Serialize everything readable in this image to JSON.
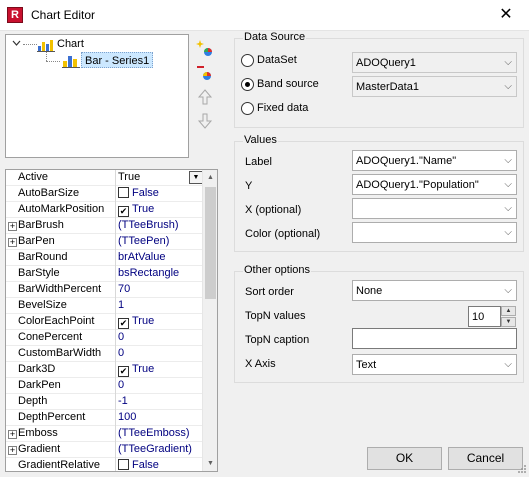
{
  "window": {
    "title": "Chart Editor",
    "close_glyph": "✕",
    "app_icon_letter": "R"
  },
  "tree": {
    "root_label": "Chart",
    "child_label": "Bar - Series1",
    "expander": "⊟"
  },
  "tree_buttons": [
    "add-series-icon",
    "delete-series-icon",
    "move-up-icon",
    "move-down-icon"
  ],
  "property_grid": {
    "rows": [
      {
        "name": "Active",
        "value": "True",
        "kind": "dropdown",
        "expandable": false
      },
      {
        "name": "AutoBarSize",
        "value": "False",
        "kind": "checkbox",
        "checked": false,
        "expandable": false
      },
      {
        "name": "AutoMarkPosition",
        "value": "True",
        "kind": "checkbox",
        "checked": true,
        "expandable": false
      },
      {
        "name": "BarBrush",
        "value": "(TTeeBrush)",
        "kind": "object",
        "expandable": true
      },
      {
        "name": "BarPen",
        "value": "(TTeePen)",
        "kind": "object",
        "expandable": true
      },
      {
        "name": "BarRound",
        "value": "brAtValue",
        "kind": "text",
        "expandable": false
      },
      {
        "name": "BarStyle",
        "value": "bsRectangle",
        "kind": "text",
        "expandable": false
      },
      {
        "name": "BarWidthPercent",
        "value": "70",
        "kind": "text",
        "expandable": false
      },
      {
        "name": "BevelSize",
        "value": "1",
        "kind": "text",
        "expandable": false
      },
      {
        "name": "ColorEachPoint",
        "value": "True",
        "kind": "checkbox",
        "checked": true,
        "expandable": false
      },
      {
        "name": "ConePercent",
        "value": "0",
        "kind": "text",
        "expandable": false
      },
      {
        "name": "CustomBarWidth",
        "value": "0",
        "kind": "text",
        "expandable": false
      },
      {
        "name": "Dark3D",
        "value": "True",
        "kind": "checkbox",
        "checked": true,
        "expandable": false
      },
      {
        "name": "DarkPen",
        "value": "0",
        "kind": "text",
        "expandable": false
      },
      {
        "name": "Depth",
        "value": "-1",
        "kind": "text",
        "expandable": false
      },
      {
        "name": "DepthPercent",
        "value": "100",
        "kind": "text",
        "expandable": false
      },
      {
        "name": "Emboss",
        "value": "(TTeeEmboss)",
        "kind": "object",
        "expandable": true
      },
      {
        "name": "Gradient",
        "value": "(TTeeGradient)",
        "kind": "object",
        "expandable": true
      },
      {
        "name": "GradientRelative",
        "value": "False",
        "kind": "checkbox",
        "checked": false,
        "expandable": false
      }
    ]
  },
  "data_source": {
    "title": "Data Source",
    "options": [
      {
        "label": "DataSet",
        "selected": false,
        "combo": "ADOQuery1",
        "disabled": true
      },
      {
        "label": "Band source",
        "selected": true,
        "combo": "MasterData1",
        "disabled": false
      },
      {
        "label": "Fixed data",
        "selected": false
      }
    ]
  },
  "values": {
    "title": "Values",
    "fields": [
      {
        "label": "Label",
        "value": "ADOQuery1.\"Name\""
      },
      {
        "label": "Y",
        "value": "ADOQuery1.\"Population\""
      },
      {
        "label": "X (optional)",
        "value": ""
      },
      {
        "label": "Color (optional)",
        "value": ""
      }
    ]
  },
  "other_options": {
    "title": "Other options",
    "sort_order": {
      "label": "Sort order",
      "value": "None"
    },
    "topn_values": {
      "label": "TopN values",
      "value": "10"
    },
    "topn_caption": {
      "label": "TopN caption",
      "value": ""
    },
    "x_axis": {
      "label": "X Axis",
      "value": "Text"
    }
  },
  "buttons": {
    "ok": "OK",
    "cancel": "Cancel"
  }
}
